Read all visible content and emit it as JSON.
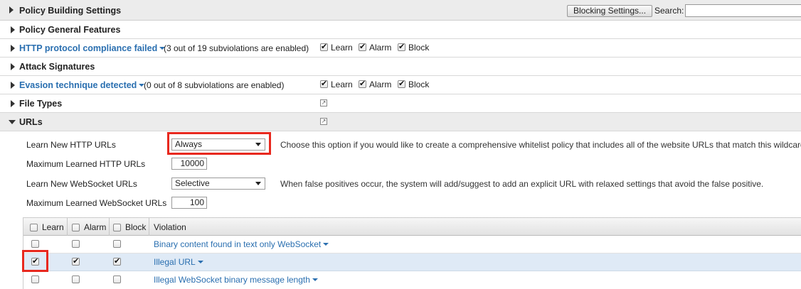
{
  "header": {
    "title": "Policy Building Settings",
    "blocking_settings_label": "Blocking Settings...",
    "search_label": "Search:",
    "search_value": ""
  },
  "sections": {
    "general": "Policy General Features",
    "http": {
      "title": "HTTP protocol compliance failed",
      "note": "(3 out of 19 subviolations are enabled)",
      "learn": "Learn",
      "alarm": "Alarm",
      "block": "Block"
    },
    "attack": "Attack Signatures",
    "evasion": {
      "title": "Evasion technique detected",
      "note": "(0 out of 8 subviolations are enabled)",
      "learn": "Learn",
      "alarm": "Alarm",
      "block": "Block"
    },
    "filetypes": "File Types",
    "urls": "URLs"
  },
  "urls": {
    "learn_http_label": "Learn New HTTP URLs",
    "learn_http_value": "Always",
    "learn_http_desc": "Choose this option if you would like to create a comprehensive whitelist policy that includes all of the website URLs that match this wildcard.",
    "max_http_label": "Maximum Learned HTTP URLs",
    "max_http_value": "10000",
    "learn_ws_label": "Learn New WebSocket URLs",
    "learn_ws_value": "Selective",
    "learn_ws_desc": "When false positives occur, the system will add/suggest to add an explicit URL with relaxed settings that avoid the false positive.",
    "max_ws_label": "Maximum Learned WebSocket URLs",
    "max_ws_value": "100"
  },
  "table": {
    "headers": {
      "learn": "Learn",
      "alarm": "Alarm",
      "block": "Block",
      "violation": "Violation"
    },
    "rows": [
      {
        "violation": "Binary content found in text only WebSocket",
        "learn": false,
        "alarm": false,
        "block": false
      },
      {
        "violation": "Illegal URL",
        "learn": true,
        "alarm": true,
        "block": true
      },
      {
        "violation": "Illegal WebSocket binary message length",
        "learn": false,
        "alarm": false,
        "block": false
      }
    ]
  },
  "colors": {
    "link": "#2a6fb0",
    "highlight": "#e8281e",
    "selected_row": "#dfeaf6"
  }
}
